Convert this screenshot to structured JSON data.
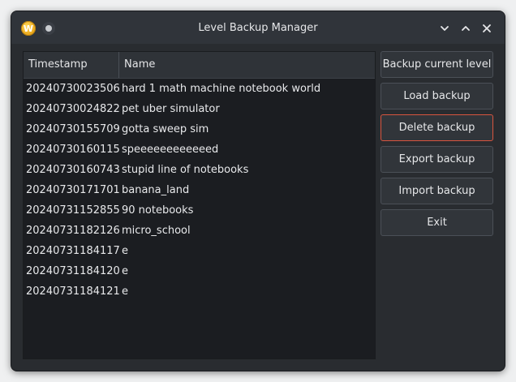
{
  "window": {
    "title": "Level Backup Manager",
    "app_icon_letter": "W"
  },
  "table": {
    "headers": {
      "timestamp": "Timestamp",
      "name": "Name"
    },
    "rows": [
      {
        "timestamp": "20240730023506",
        "name": "hard 1 math machine notebook world"
      },
      {
        "timestamp": "20240730024822",
        "name": "pet uber simulator"
      },
      {
        "timestamp": "20240730155709",
        "name": "gotta sweep sim"
      },
      {
        "timestamp": "20240730160115",
        "name": "speeeeeeeeeeeed"
      },
      {
        "timestamp": "20240730160743",
        "name": "stupid line of notebooks"
      },
      {
        "timestamp": "20240730171701",
        "name": "banana_land"
      },
      {
        "timestamp": "20240731152855",
        "name": "90 notebooks"
      },
      {
        "timestamp": "20240731182126",
        "name": "micro_school"
      },
      {
        "timestamp": "20240731184117",
        "name": "e"
      },
      {
        "timestamp": "20240731184120",
        "name": "e"
      },
      {
        "timestamp": "20240731184121",
        "name": "e"
      }
    ]
  },
  "buttons": {
    "backup_current": "Backup current level",
    "load": "Load backup",
    "delete": "Delete backup",
    "export": "Export backup",
    "import": "Import backup",
    "exit": "Exit"
  },
  "colors": {
    "window_bg": "#292c30",
    "focus_border": "#d9553f"
  }
}
